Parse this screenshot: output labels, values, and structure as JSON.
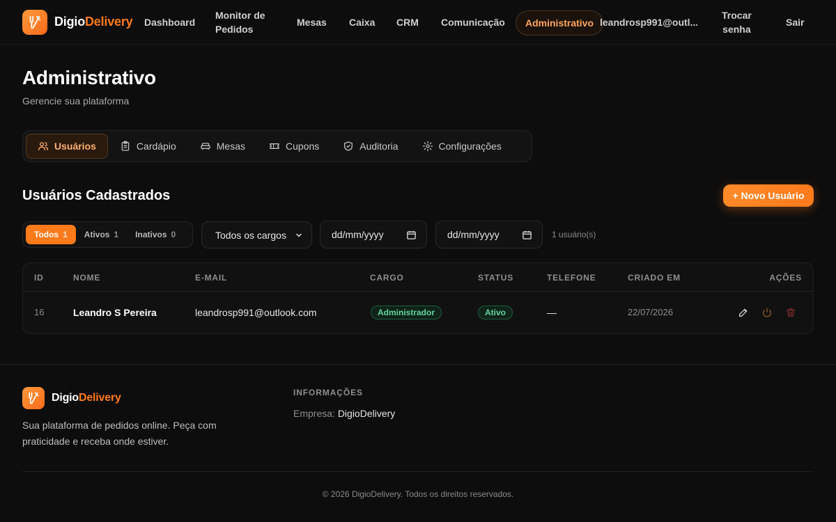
{
  "brand": {
    "part1": "Digio",
    "part2": "Delivery",
    "accent": "#ff7a1a"
  },
  "nav": {
    "dashboard": "Dashboard",
    "monitor_line1": "Monitor de",
    "monitor_line2": "Pedidos",
    "mesas": "Mesas",
    "caixa": "Caixa",
    "crm": "CRM",
    "comunicacao": "Comunicação",
    "administrativo": "Administrativo",
    "user_email": "leandrosp991@outl...",
    "trocar_line1": "Trocar",
    "trocar_line2": "senha",
    "sair": "Sair"
  },
  "header": {
    "title": "Administrativo",
    "subtitle": "Gerencie sua plataforma"
  },
  "tabs": [
    {
      "label": "Usuários",
      "icon": "users-icon",
      "active": true
    },
    {
      "label": "Cardápio",
      "icon": "clipboard-icon"
    },
    {
      "label": "Mesas",
      "icon": "sofa-icon"
    },
    {
      "label": "Cupons",
      "icon": "ticket-icon"
    },
    {
      "label": "Auditoria",
      "icon": "shield-icon"
    },
    {
      "label": "Configurações",
      "icon": "gear-icon"
    }
  ],
  "section": {
    "title": "Usuários Cadastrados",
    "new_button": "+ Novo Usuário"
  },
  "filters": {
    "status": [
      {
        "label": "Todos",
        "count": "1",
        "active": true
      },
      {
        "label": "Ativos",
        "count": "1"
      },
      {
        "label": "Inativos",
        "count": "0"
      }
    ],
    "role_select": "Todos os cargos",
    "date_from": "dd/mm/yyyy",
    "date_to": "dd/mm/yyyy",
    "result_count": "1 usuário(s)"
  },
  "table": {
    "columns": [
      "ID",
      "NOME",
      "E-MAIL",
      "CARGO",
      "STATUS",
      "TELEFONE",
      "CRIADO EM",
      "AÇÕES"
    ],
    "rows": [
      {
        "id": "16",
        "name": "Leandro S Pereira",
        "email": "leandrosp991@outlook.com",
        "role": "Administrador",
        "status": "Ativo",
        "phone": "—",
        "created": "22/07/2026"
      }
    ]
  },
  "footer": {
    "description": "Sua plataforma de pedidos online. Peça com praticidade e receba onde estiver.",
    "info_title": "INFORMAÇÕES",
    "company_label": "Empresa:",
    "company_value": "DigioDelivery",
    "copyright": "© 2026 DigioDelivery. Todos os direitos reservados."
  }
}
